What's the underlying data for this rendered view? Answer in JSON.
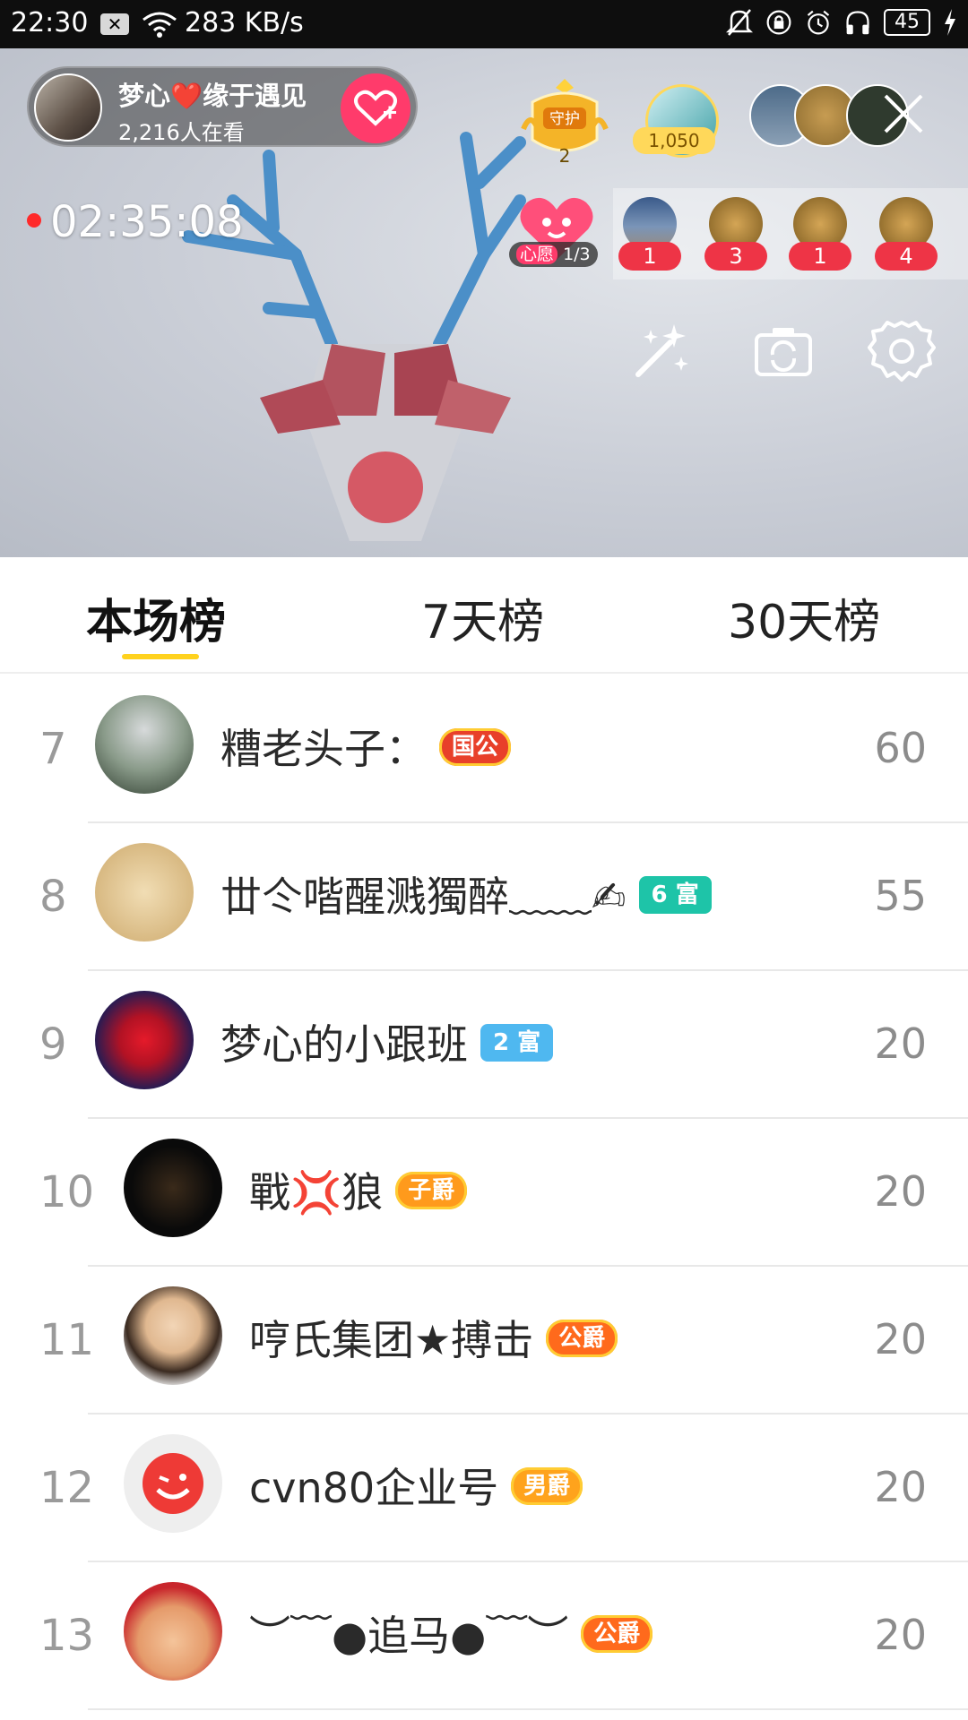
{
  "status_bar": {
    "time": "22:30",
    "notification_icon": "close-box-icon",
    "network_speed": "283 KB/s",
    "battery": "45",
    "icons": [
      "mute-bell-icon",
      "lock-rotation-icon",
      "alarm-icon",
      "headphones-icon",
      "battery-icon",
      "charging-bolt-icon"
    ]
  },
  "live": {
    "host_name": "梦心❤️缘于遇见",
    "viewers": "2,216人在看",
    "timer": "02:35:08",
    "guard_label": "守护",
    "guard_count": "2",
    "top_fan_score": "1,050",
    "wish_label_a": "心愿",
    "wish_label_b": "1/3",
    "gift_counts": [
      "1",
      "3",
      "1",
      "4"
    ],
    "colors": {
      "accent": "#ff3b6b",
      "gift_badge": "#ee3446",
      "tab_underline": "#ffd21e"
    }
  },
  "tabs": [
    {
      "label": "本场榜",
      "active": true
    },
    {
      "label": "7天榜",
      "active": false
    },
    {
      "label": "30天榜",
      "active": false
    }
  ],
  "ranking": [
    {
      "rank": "7",
      "name": "糟老头子：",
      "badge": "国公",
      "badge_color": "#e8402a",
      "score": "60"
    },
    {
      "rank": "8",
      "name": "丗仒喈醒溅獨醉﹏﹏✍",
      "badge": "6 富",
      "badge_color": "#1ec4a8",
      "score": "55"
    },
    {
      "rank": "9",
      "name": "梦心的小跟班",
      "badge": "2 富",
      "badge_color": "#4fb8f0",
      "score": "20"
    },
    {
      "rank": "10",
      "name": "戰💢狼",
      "badge": "子爵",
      "badge_color": "#ff9a1c",
      "score": "20"
    },
    {
      "rank": "11",
      "name": "哼氏集团★搏击",
      "badge": "公爵",
      "badge_color": "#ff6a1c",
      "score": "20"
    },
    {
      "rank": "12",
      "name": "cvn80企业号",
      "badge": "男爵",
      "badge_color": "#ffa31c",
      "score": "20"
    },
    {
      "rank": "13",
      "name": "︶﹋●追马●﹋︶",
      "badge": "公爵",
      "badge_color": "#ff6a1c",
      "score": "20"
    }
  ]
}
